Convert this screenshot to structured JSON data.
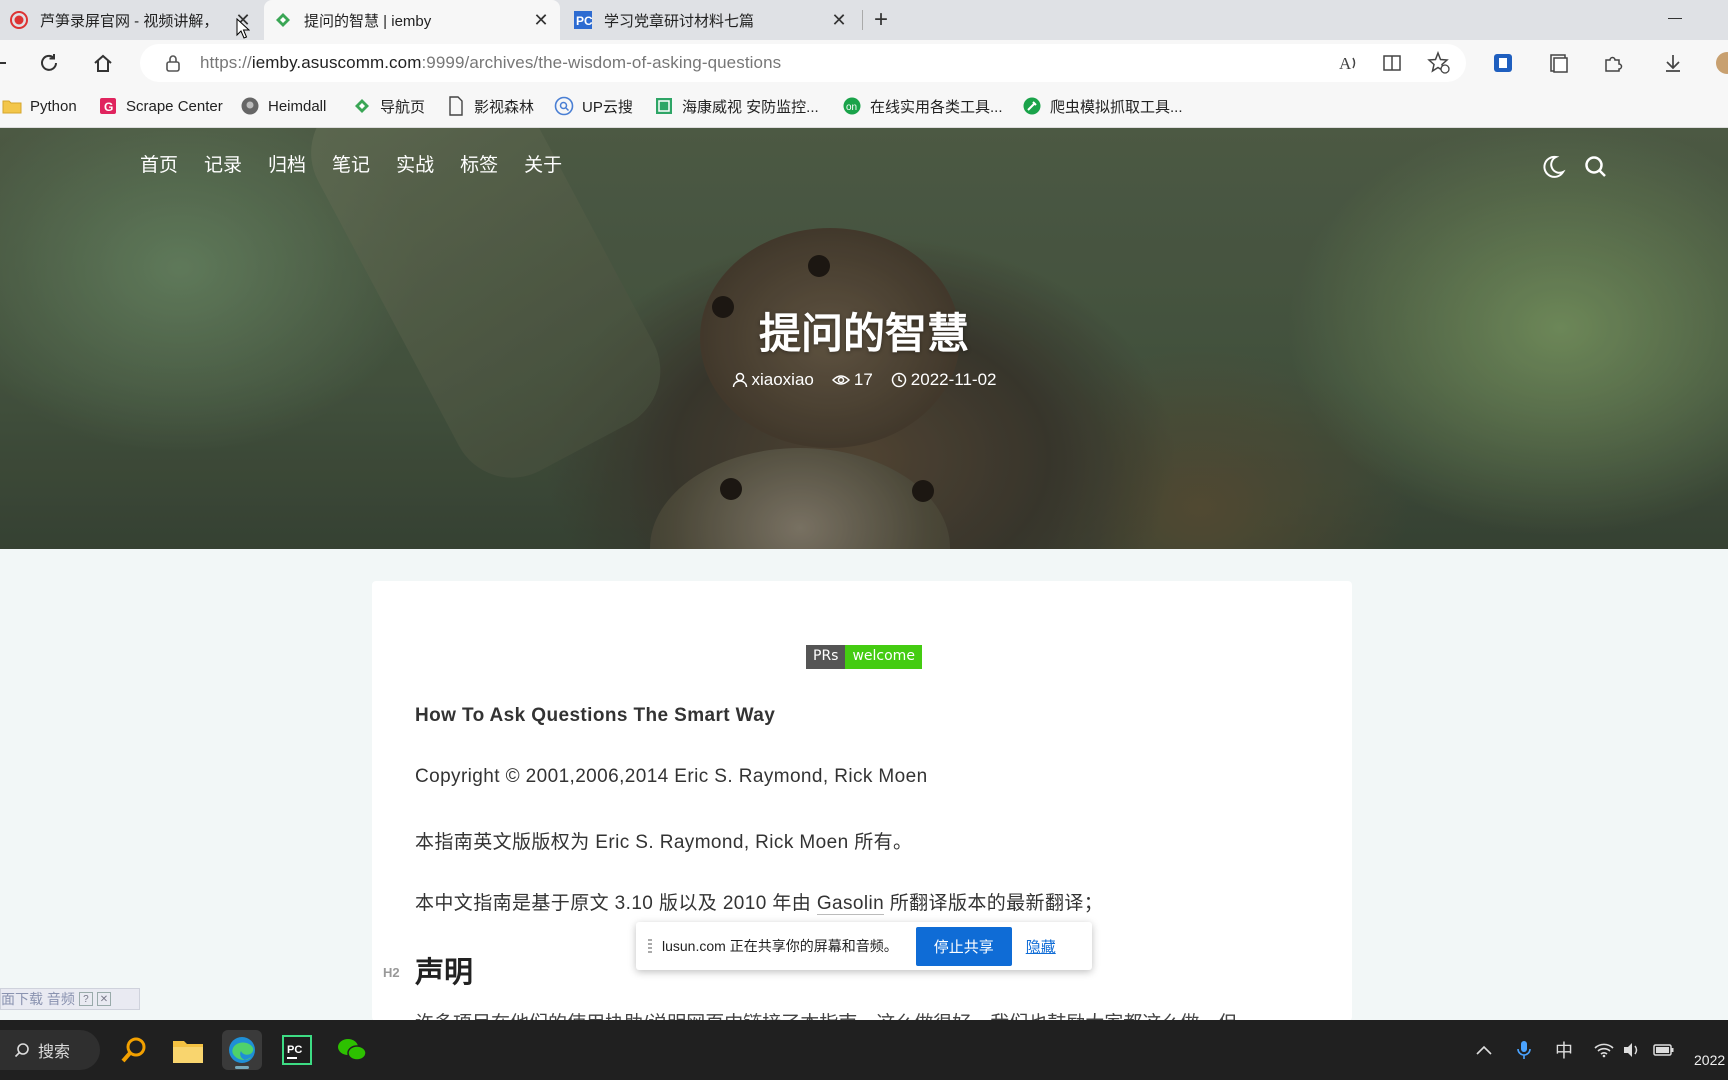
{
  "browser": {
    "tabs": [
      {
        "title": "芦笋录屏官网 - 视频讲解，",
        "icon": "record-icon"
      },
      {
        "title": "提问的智慧 | iemby",
        "icon": "iemby-icon"
      },
      {
        "title": "学习党章研讨材料七篇",
        "icon": "pycharm-icon"
      }
    ],
    "url_prefix": "https://",
    "url_host": "iemby.asuscomm.com",
    "url_rest": ":9999/archives/the-wisdom-of-asking-questions",
    "bookmarks": [
      {
        "label": "Python",
        "icon": "folder-icon"
      },
      {
        "label": "Scrape Center",
        "icon": "scrape-center-icon"
      },
      {
        "label": "Heimdall",
        "icon": "heimdall-icon"
      },
      {
        "label": "导航页",
        "icon": "nav-icon"
      },
      {
        "label": "影视森林",
        "icon": "page-icon"
      },
      {
        "label": "UP云搜",
        "icon": "search-cloud-icon"
      },
      {
        "label": "海康威视 安防监控...",
        "icon": "hikvision-icon"
      },
      {
        "label": "在线实用各类工具...",
        "icon": "tools-icon"
      },
      {
        "label": "爬虫模拟抓取工具...",
        "icon": "crawler-icon"
      }
    ]
  },
  "site": {
    "menu": [
      "首页",
      "记录",
      "归档",
      "笔记",
      "实战",
      "标签",
      "关于"
    ],
    "title": "提问的智慧",
    "author": "xiaoxiao",
    "views": "17",
    "date": "2022-11-02"
  },
  "article": {
    "badge_left": "PRs",
    "badge_right": "welcome",
    "p1": "How To Ask Questions The Smart Way",
    "p2": "Copyright © 2001,2006,2014 Eric S. Raymond, Rick Moen",
    "p3": "本指南英文版版权为 Eric S. Raymond, Rick Moen 所有。",
    "p4_before": "本中文指南是基于原文 3.10 版以及 2010 年由 ",
    "p4_link": "Gasolin",
    "p4_after": " 所翻译版本的最新翻译；",
    "h2_tag": "H2",
    "h2": "声明",
    "cut_line": "许多项目在他们的使用协助/说明网页中链接了本指南，这么做很好，我们也鼓励大家都这么做。但"
  },
  "share_popup": {
    "message": "lusun.com 正在共享你的屏幕和音频。",
    "stop": "停止共享",
    "hide": "隐藏"
  },
  "mini_widget": {
    "text": "面下载 音频"
  },
  "taskbar": {
    "search": "搜索",
    "ime": "中",
    "clock": "2022"
  }
}
